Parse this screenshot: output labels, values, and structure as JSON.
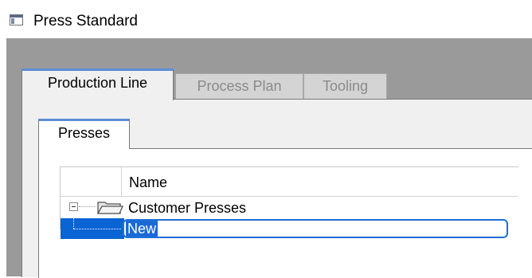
{
  "window": {
    "title": "Press Standard",
    "icon": "window-app-icon"
  },
  "main_tabs": [
    {
      "label": "Production Line",
      "active": true
    },
    {
      "label": "Process Plan",
      "active": false
    },
    {
      "label": "Tooling",
      "active": false
    }
  ],
  "sub_tabs": [
    {
      "label": "Presses",
      "active": true
    }
  ],
  "tree": {
    "header": {
      "name": "Name"
    },
    "rows": [
      {
        "label": "Customer Presses",
        "icon": "folder-icon",
        "expanded": true
      },
      {
        "edit_value": "New",
        "editing": true,
        "selected": true
      }
    ]
  },
  "colors": {
    "frame_gray": "#9a9a9a",
    "accent_blue": "#5d8ed8",
    "selection_blue": "#0a64d4"
  }
}
